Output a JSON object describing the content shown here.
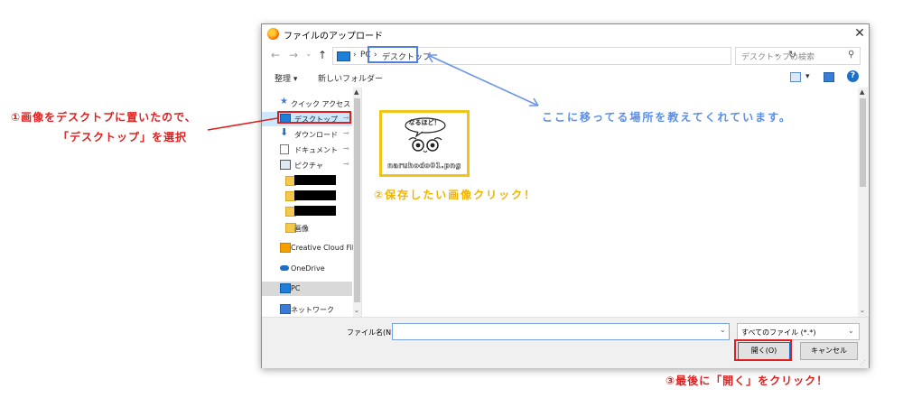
{
  "dialog": {
    "title": "ファイルのアップロード",
    "close_glyph": "✕"
  },
  "nav": {
    "back": "←",
    "forward": "→",
    "dropdown": "⌄",
    "up": "↑",
    "breadcrumb": [
      "PC",
      "デスクトップ"
    ],
    "separator": "›",
    "refresh": "↻",
    "search_placeholder": "デスクトップの検索",
    "search_glyph": "⚲"
  },
  "toolbar": {
    "organize": "整理 ▾",
    "new_folder": "新しいフォルダー",
    "view_dropdown": "▾",
    "help": "?"
  },
  "sidebar": {
    "scroll_up": "▲",
    "scroll_down": "⌄",
    "pin_glyph": "📌",
    "items": [
      {
        "label": "クイック アクセス",
        "icon": "star-icon"
      },
      {
        "label": "デスクトップ",
        "icon": "desktop-icon",
        "pinned": true
      },
      {
        "label": "ダウンロード",
        "icon": "download-icon",
        "pinned": true
      },
      {
        "label": "ドキュメント",
        "icon": "document-icon",
        "pinned": true
      },
      {
        "label": "ピクチャ",
        "icon": "picture-icon",
        "pinned": true
      },
      {
        "label": "",
        "icon": "folder-icon",
        "redacted": true
      },
      {
        "label": "",
        "icon": "folder-icon",
        "redacted": true
      },
      {
        "label": "",
        "icon": "folder-icon",
        "redacted": true
      },
      {
        "label": "画像",
        "icon": "folder-icon"
      },
      {
        "label": "Creative Cloud File",
        "icon": "creative-cloud-icon"
      },
      {
        "label": "OneDrive",
        "icon": "onedrive-icon"
      },
      {
        "label": "PC",
        "icon": "pc-icon",
        "selected": true
      },
      {
        "label": "ネットワーク",
        "icon": "network-icon"
      }
    ]
  },
  "files": [
    {
      "name": "naruhodo01.png",
      "thumbnail_text": "なるほど！"
    }
  ],
  "bottom": {
    "filename_label": "ファイル名(N):",
    "filename_value": "",
    "filter_value": "すべてのファイル (*.*)",
    "dropdown_glyph": "⌄",
    "open_label": "開く(O)",
    "cancel_label": "キャンセル"
  },
  "annotations": {
    "step1_line1": "①画像をデスクトプに置いたので、",
    "step1_line2": "「デスクトップ」を選択",
    "location_note": "ここに移ってる場所を教えてくれています。",
    "step2": "②保存したい画像クリック！",
    "step3": "③最後に「開く」をクリック！"
  },
  "colors": {
    "annotation_red": "#e02020",
    "annotation_blue": "#5b8ee6",
    "annotation_yellow": "#f0b400",
    "selection_blue": "#0078d7"
  }
}
